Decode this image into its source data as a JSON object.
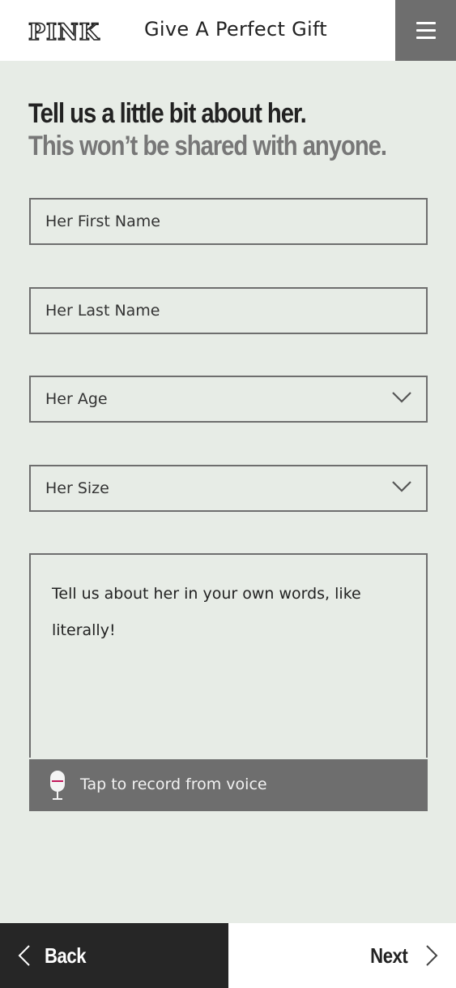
{
  "header": {
    "logo": "PINK",
    "title": "Give A Perfect Gift",
    "menu_icon": "hamburger-icon"
  },
  "intro": {
    "line1": "Tell us a little bit about her.",
    "line2": "This won’t be shared with anyone."
  },
  "form": {
    "first_name": {
      "placeholder": "Her First Name",
      "value": ""
    },
    "last_name": {
      "placeholder": "Her Last Name",
      "value": ""
    },
    "age": {
      "selected": "Her Age",
      "icon": "chevron-down-icon"
    },
    "size": {
      "selected": "Her Size",
      "icon": "chevron-down-icon"
    },
    "description": {
      "placeholder": "Tell us about her in your own words, like literally!"
    },
    "voice": {
      "label": "Tap to record from voice",
      "icon": "microphone-icon"
    }
  },
  "footer": {
    "back_label": "Back",
    "next_label": "Next"
  },
  "colors": {
    "background": "#e7ece6",
    "header_bg": "#ffffff",
    "menu_bg": "#6e6e6e",
    "border": "#6e6e6e",
    "back_bg": "#262626",
    "next_bg": "#ffffff",
    "mic_accent": "#c2185b"
  }
}
